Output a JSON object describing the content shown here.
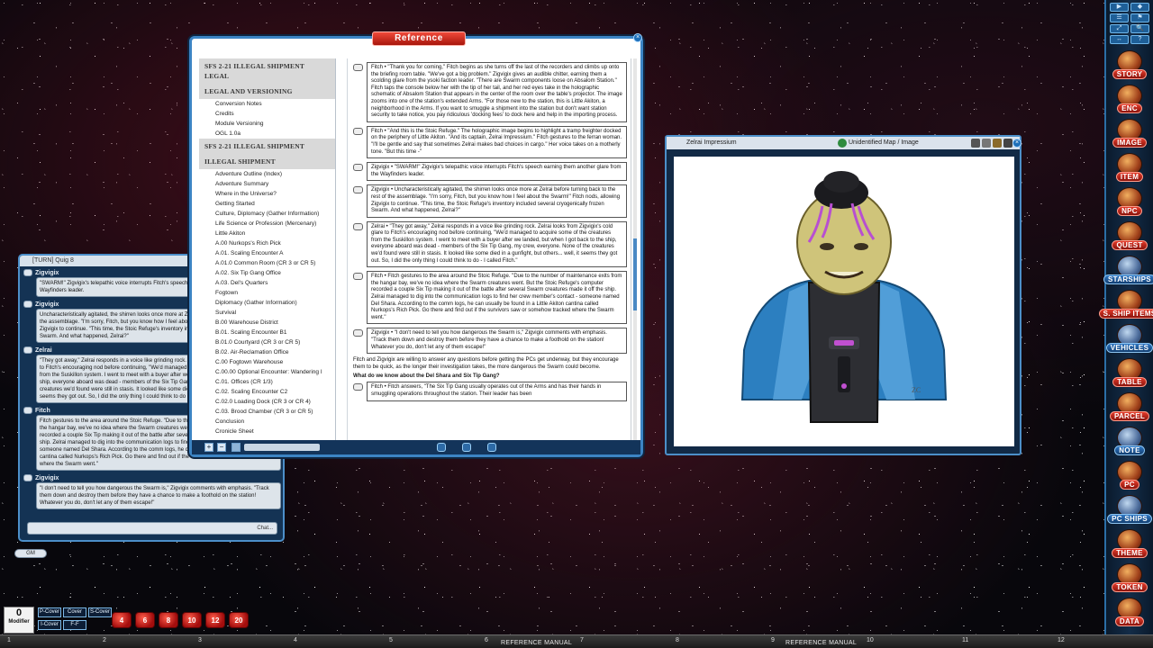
{
  "sidebar": {
    "tools": [
      "▶",
      "◆",
      "☰",
      "⚑",
      "⤢",
      "🔍",
      "↔",
      "?"
    ],
    "items": [
      {
        "label": "STORY",
        "style": "red"
      },
      {
        "label": "ENC",
        "style": "red"
      },
      {
        "label": "IMAGE",
        "style": "red"
      },
      {
        "label": "ITEM",
        "style": "red"
      },
      {
        "label": "NPC",
        "style": "red"
      },
      {
        "label": "QUEST",
        "style": "red"
      },
      {
        "label": "STARSHIPS",
        "style": "blue"
      },
      {
        "label": "S. SHIP ITEMS",
        "style": "red"
      },
      {
        "label": "VEHICLES",
        "style": "blue"
      },
      {
        "label": "TABLE",
        "style": "red"
      },
      {
        "label": "PARCEL",
        "style": "red"
      },
      {
        "label": "NOTE",
        "style": "blue"
      },
      {
        "label": "PC",
        "style": "red"
      },
      {
        "label": "PC SHIPS",
        "style": "blue"
      },
      {
        "label": "THEME",
        "style": "red"
      },
      {
        "label": "TOKEN",
        "style": "red"
      },
      {
        "label": "DATA",
        "style": "red"
      }
    ]
  },
  "bottombar": {
    "ticks": [
      "1",
      "2",
      "3",
      "4",
      "5",
      "6",
      "7",
      "8",
      "9",
      "10",
      "11",
      "12"
    ],
    "manual_labels": [
      "REFERENCE MANUAL",
      "REFERENCE MANUAL"
    ]
  },
  "hotkeys": {
    "modifier_value": "0",
    "modifier_label": "Modifier",
    "cover_buttons": [
      "P-Cover",
      "Cover",
      "S-Cover",
      "I-Cover",
      "F-F"
    ],
    "dice": [
      "4",
      "6",
      "8",
      "10",
      "12",
      "20"
    ]
  },
  "gm_tag": "GM",
  "chat": {
    "header": "[TURN] Quig 8",
    "input_hint": "Chat...",
    "messages": [
      {
        "name": "Zigvigix",
        "text": "\"SWARM!\" Zigvigix's telepathic voice interrupts Fitch's speech earning them another glare from the Wayfinders leader."
      },
      {
        "name": "Zigvigix",
        "text": "Uncharacteristically agitated, the shirren looks once more at Zelrai before turning back to the rest of the assemblage. \"I'm sorry, Fitch, but you know how I feel about the Swarm!\" Fitch nods, allowing Zigvigix to continue. \"This time, the Stoic Refuge's inventory included several cryogenically frozen Swarm. And what happened, Zelrai?\""
      },
      {
        "name": "Zelrai",
        "text": "\"They got away,\" Zelrai responds in a voice like grinding rock. Zelrai looks from Zigvigix's cold glare to Fitch's encouraging nod before continuing, \"We'd managed to acquire some of the creatures from the Suskillon system. I went to meet with a buyer after we landed, but when I got back to the ship, everyone aboard was dead - members of the Six Tip Gang, my crew, everyone. None of the creatures we'd found were still in stasis. It looked like some died in a gunfight, but others... well, it seems they got out. So, I did the only thing I could think to do - I called Fitch.\""
      },
      {
        "name": "Fitch",
        "text": "Fitch gestures to the area around the Stoic Refuge. \"Due to the number of maintenance exits from the hangar bay, we've no idea where the Swarm creatures went. But the Stoic Refuge's computer recorded a couple Six Tip making it out of the battle after several Swarm creatures made it off the ship. Zelrai managed to dig into the communication logs to find her crew member's contact - someone named Del Shara. According to the comm logs, he can usually be found in a Little Akiton cantina called Nurkops's Rich Pick. Go there and find out if the survivors saw or somehow tracked where the Swarm went.\""
      },
      {
        "name": "Zigvigix",
        "text": "\"I don't need to tell you how dangerous the Swarm is,\" Zigvigix comments with emphasis. \"Track them down and destroy them before they have a chance to make a foothold on the station! Whatever you do, don't let any of them escape!\""
      }
    ]
  },
  "reference": {
    "title": "Reference",
    "toc": [
      {
        "type": "head",
        "text": "SFS 2-21 ILLEGAL SHIPMENT LEGAL"
      },
      {
        "type": "head",
        "text": "LEGAL AND VERSIONING"
      },
      {
        "type": "item",
        "text": "Conversion Notes"
      },
      {
        "type": "item",
        "text": "Credits"
      },
      {
        "type": "item",
        "text": "Module Versioning"
      },
      {
        "type": "item",
        "text": "OGL 1.0a"
      },
      {
        "type": "head",
        "text": "SFS 2-21 ILLEGAL SHIPMENT"
      },
      {
        "type": "head",
        "text": "ILLEGAL SHIPMENT"
      },
      {
        "type": "item",
        "text": "Adventure Outline (Index)"
      },
      {
        "type": "item",
        "text": "Adventure Summary"
      },
      {
        "type": "item",
        "text": "Where in the Universe?"
      },
      {
        "type": "item",
        "text": "Getting Started"
      },
      {
        "type": "item",
        "text": "Culture, Diplomacy (Gather Information)"
      },
      {
        "type": "item",
        "text": "Life Science or Profession (Mercenary)"
      },
      {
        "type": "item",
        "text": "Little Akiton"
      },
      {
        "type": "item",
        "text": "A.00 Nurkops's Rich Pick"
      },
      {
        "type": "item",
        "text": "A.01. Scaling Encounter A"
      },
      {
        "type": "item",
        "text": "A.01.0 Common Room (CR 3 or CR 5)"
      },
      {
        "type": "item",
        "text": "A.02. Six Tip Gang Office"
      },
      {
        "type": "item",
        "text": "A.03. Del's Quarters"
      },
      {
        "type": "item",
        "text": "Fogtown"
      },
      {
        "type": "item",
        "text": "Diplomacy (Gather Information)"
      },
      {
        "type": "item",
        "text": "Survival"
      },
      {
        "type": "item",
        "text": "B.00 Warehouse District"
      },
      {
        "type": "item",
        "text": "B.01. Scaling Encounter B1"
      },
      {
        "type": "item",
        "text": "B.01.0 Courtyard (CR 3 or CR 5)"
      },
      {
        "type": "item",
        "text": "B.02. Air-Reclamation Office"
      },
      {
        "type": "item",
        "text": "C.00 Fogtown Warehouse"
      },
      {
        "type": "item",
        "text": "C.00.00 Optional Encounter: Wandering I"
      },
      {
        "type": "item",
        "text": "C.01. Offices (CR 1/3)"
      },
      {
        "type": "item",
        "text": "C.02. Scaling Encounter C2"
      },
      {
        "type": "item",
        "text": "C.02.0 Loading Dock (CR 3 or CR 4)"
      },
      {
        "type": "item",
        "text": "C.03. Brood Chamber (CR 3 or CR 5)"
      },
      {
        "type": "item",
        "text": "Conclusion"
      },
      {
        "type": "item",
        "text": "Cronicle Sheet"
      }
    ],
    "content": [
      {
        "type": "block",
        "text": "Fitch • \"Thank you for coming,\" Fitch begins as she turns off the last of the recorders and climbs up onto the briefing room table. \"We've got a big problem.\" Zigvigix gives an audible chitter, earning them a scolding glare from the ysoki faction leader. \"There are Swarm components loose on Absalom Station.\" Fitch taps the console below her with the tip of her tail, and her red eyes take in the holographic schematic of Absalom Station that appears in the center of the room over the table's projector. The image zooms into one of the station's extended Arms. \"For those new to the station, this is Little Akiton, a neighborhood in the Arms. If you want to smuggle a shipment into the station but don't want station security to take notice, you pay ridiculous 'docking fees' to dock here and help in the importing process."
      },
      {
        "type": "block",
        "text": "Fitch • \"And this is the Stoic Refuge.\" The holographic image begins to highlight a tramp freighter docked on the periphery of Little Akiton. \"And its captain, Zelrai Impressium.\" Fitch gestures to the ferran woman. \"I'll be gentle and say that sometimes Zelrai makes bad choices in cargo.\" Her voice takes on a motherly tone. \"But this time -\""
      },
      {
        "type": "block",
        "text": "Zigvigix • \"SWARM!\" Zigvigix's telepathic voice interrupts Fitch's speech earning them another glare from the Wayfinders leader."
      },
      {
        "type": "block",
        "text": "Zigvigix • Uncharacteristically agitated, the shirren looks once more at Zelrai before turning back to the rest of the assemblage. \"I'm sorry, Fitch, but you know how I feel about the Swarm!\" Fitch nods, allowing Zigvigix to continue. \"This time, the Stoic Refuge's inventory included several cryogenically frozen Swarm. And what happened, Zelrai?\""
      },
      {
        "type": "block",
        "text": "Zelrai • \"They got away,\" Zelrai responds in a voice like grinding rock. Zelrai looks from Zigvigix's cold glare to Fitch's encouraging nod before continuing, \"We'd managed to acquire some of the creatures from the Suskillon system. I went to meet with a buyer after we landed, but when I got back to the ship, everyone aboard was dead - members of the Six Tip Gang, my crew, everyone. None of the creatures we'd found were still in stasis. It looked like some died in a gunfight, but others... well, it seems they got out. So, I did the only thing I could think to do - I called Fitch.\""
      },
      {
        "type": "block",
        "text": "Fitch • Fitch gestures to the area around the Stoic Refuge. \"Due to the number of maintenance exits from the hangar bay, we've no idea where the Swarm creatures went. But the Stoic Refuge's computer recorded a couple Six Tip making it out of the battle after several Swarm creatures made it off the ship. Zelrai managed to dig into the communication logs to find her crew member's contact - someone named Del Shara. According to the comm logs, he can usually be found in a Little Akiton cantina called Nurkops's Rich Pick. Go there and find out if the survivors saw or somehow tracked where the Swarm went.\""
      },
      {
        "type": "block",
        "text": "Zigvigix • \"I don't need to tell you how dangerous the Swarm is,\" Zigvigix comments with emphasis. \"Track them down and destroy them before they have a chance to make a foothold on the station! Whatever you do, don't let any of them escape!\""
      },
      {
        "type": "para",
        "text": "Fitch and Zigvigix are willing to answer any questions before getting the PCs get underway, but they encourage them to be quick, as the longer their investigation takes, the more dangerous the Swarm could become."
      },
      {
        "type": "heading",
        "text": "What do we know about the Del Shara and Six Tip Gang?"
      },
      {
        "type": "block",
        "text": "Fitch • Fitch answers, \"The Six Tip Gang usually operates out of the Arms and has their hands in smuggling operations throughout the station. Their leader has been"
      }
    ]
  },
  "image_window": {
    "left_title": "Zelrai Impressium",
    "right_title": "Unidentified Map / Image"
  }
}
